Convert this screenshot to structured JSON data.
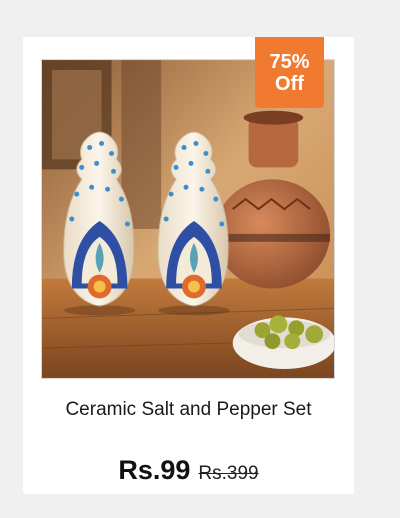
{
  "product": {
    "title": "Ceramic Salt and Pepper Set",
    "price": "Rs.99",
    "original_price": "Rs.399",
    "image_icon": "salt-pepper-shakers-photo"
  },
  "badge": {
    "percent": "75%",
    "suffix": "Off",
    "color": "#f07a2f"
  }
}
